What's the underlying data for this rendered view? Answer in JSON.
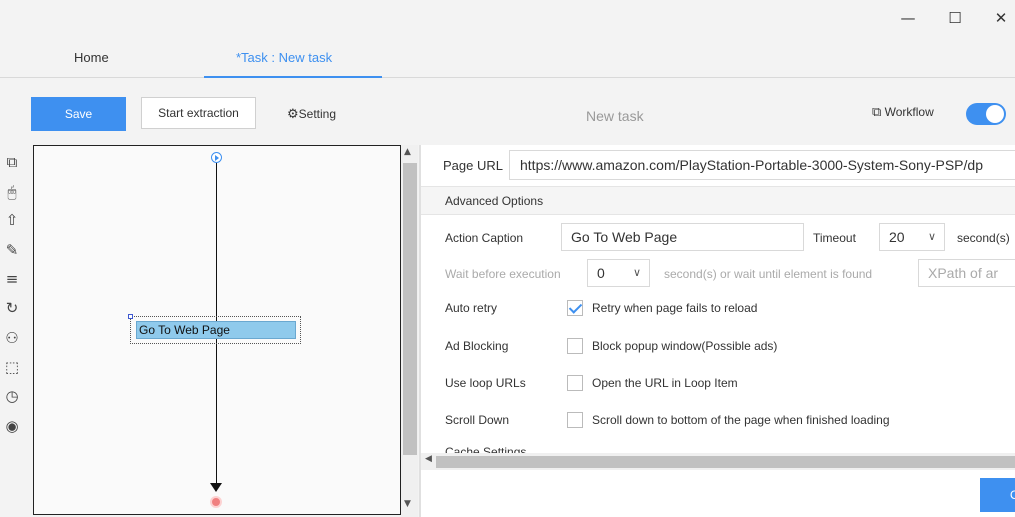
{
  "window": {
    "minimize": "—",
    "maximize": "☐",
    "close": "✕"
  },
  "tabs": [
    {
      "label": "Home"
    },
    {
      "label": "*Task : New task"
    }
  ],
  "toolbar": {
    "save_label": "Save",
    "start_label": "Start extraction",
    "setting_label": "Setting",
    "task_name": "New task",
    "workflow_label": "Workflow",
    "workflow_on": true
  },
  "sidebar_icons": [
    "add-step-icon",
    "click-icon",
    "extract-icon",
    "input-text-icon",
    "switch-dropdown-icon",
    "loop-icon",
    "condition-icon",
    "mouseover-icon",
    "wait-icon",
    "stop-icon"
  ],
  "canvas": {
    "node_label": "Go To Web Page"
  },
  "panel": {
    "page_url_label": "Page URL",
    "page_url_value": "https://www.amazon.com/PlayStation-Portable-3000-System-Sony-PSP/dp",
    "advanced_options": "Advanced Options",
    "action_caption_label": "Action Caption",
    "action_caption_value": "Go To Web Page",
    "timeout_label": "Timeout",
    "timeout_value": "20",
    "timeout_unit": "second(s)",
    "wait_label": "Wait before execution",
    "wait_value": "0",
    "wait_suffix": "second(s)  or wait until element is found",
    "xpath_placeholder": "XPath of ar",
    "auto_retry_label": "Auto retry",
    "auto_retry_text": "Retry when page fails to reload",
    "auto_retry_checked": true,
    "ad_blocking_label": "Ad Blocking",
    "ad_blocking_text": "Block popup window(Possible ads)",
    "loop_urls_label": "Use loop URLs",
    "loop_urls_text": "Open the URL in Loop Item",
    "scroll_label": "Scroll Down",
    "scroll_text": "Scroll down to bottom of the page when finished loading",
    "cache_label": "Cache Settings",
    "ok_label": "OK"
  }
}
